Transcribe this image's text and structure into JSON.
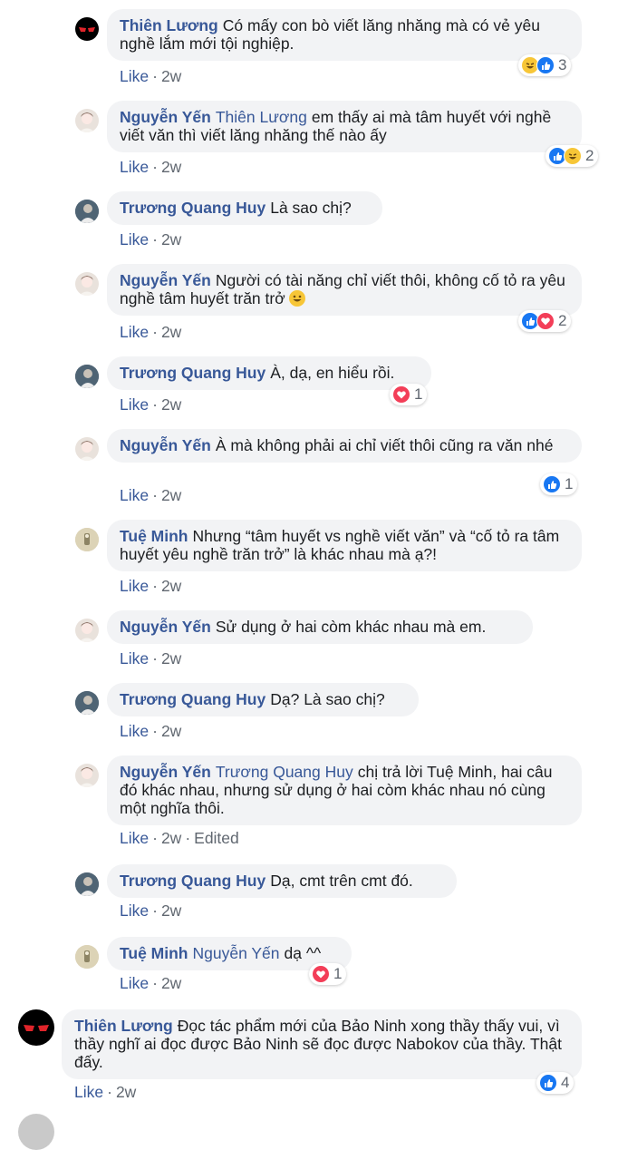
{
  "meta_like": "Like",
  "meta_sep": "·",
  "comments": [
    {
      "author": "Thiên Lương",
      "mention": "",
      "text": "Có mấy con bò viết lăng nhăng mà có vẻ yêu nghề lắm mới tội nghiệp.",
      "time": "2w",
      "edited": "",
      "reactions": [
        "haha",
        "like"
      ],
      "count": "3"
    },
    {
      "author": "Nguyễn Yến",
      "mention": "Thiên Lương",
      "text": "em thấy ai mà tâm huyết với nghề viết văn thì viết lăng nhăng thế nào ấy",
      "time": "2w",
      "edited": "",
      "reactions": [
        "like",
        "haha"
      ],
      "count": "2"
    },
    {
      "author": "Trương Quang Huy",
      "mention": "",
      "text": "Là sao chị?",
      "time": "2w",
      "edited": "",
      "reactions": [],
      "count": ""
    },
    {
      "author": "Nguyễn Yến",
      "mention": "",
      "text": "Người có tài năng chỉ viết thôi, không cố tỏ ra yêu nghề tâm huyết trăn trở",
      "time": "2w",
      "edited": "",
      "reactions": [
        "like",
        "love"
      ],
      "count": "2",
      "inline_emoji": "smile"
    },
    {
      "author": "Trương Quang Huy",
      "mention": "",
      "text": "À, dạ, en hiểu rồi.",
      "time": "2w",
      "edited": "",
      "reactions": [
        "love"
      ],
      "count": "1"
    },
    {
      "author": "Nguyễn Yến",
      "mention": "",
      "text": "À mà không phải ai chỉ viết thôi cũng ra văn nhé",
      "time": "2w",
      "edited": "",
      "reactions": [
        "like"
      ],
      "count": "1"
    },
    {
      "author": "Tuệ Minh",
      "mention": "",
      "text": "Nhưng “tâm huyết vs nghề viết văn” và “cố tỏ ra tâm huyết yêu nghề trăn trở” là khác nhau mà ạ?!",
      "time": "2w",
      "edited": "",
      "reactions": [],
      "count": ""
    },
    {
      "author": "Nguyễn Yến",
      "mention": "",
      "text": "Sử dụng ở hai còm khác nhau mà em.",
      "time": "2w",
      "edited": "",
      "reactions": [],
      "count": ""
    },
    {
      "author": "Trương Quang Huy",
      "mention": "",
      "text": "Dạ? Là sao chị?",
      "time": "2w",
      "edited": "",
      "reactions": [],
      "count": ""
    },
    {
      "author": "Nguyễn Yến",
      "mention": "Trương Quang Huy",
      "text": "chị trả lời Tuệ Minh, hai câu đó khác nhau, nhưng sử dụng ở hai còm khác nhau nó cùng một nghĩa thôi.",
      "time": "2w",
      "edited": "Edited",
      "reactions": [],
      "count": ""
    },
    {
      "author": "Trương Quang Huy",
      "mention": "",
      "text": "Dạ, cmt trên cmt đó.",
      "time": "2w",
      "edited": "",
      "reactions": [],
      "count": ""
    },
    {
      "author": "Tuệ Minh",
      "mention": "Nguyễn Yến",
      "text": "dạ ^^",
      "time": "2w",
      "edited": "",
      "reactions": [
        "love"
      ],
      "count": "1"
    },
    {
      "author": "Thiên Lương",
      "mention": "",
      "text": "Đọc tác phẩm mới của Bảo Ninh xong thầy thấy vui, vì thầy nghĩ ai đọc được Bảo Ninh sẽ đọc được Nabokov của thầy. Thật đấy.",
      "time": "2w",
      "edited": "",
      "reactions": [
        "like"
      ],
      "count": "4"
    }
  ]
}
